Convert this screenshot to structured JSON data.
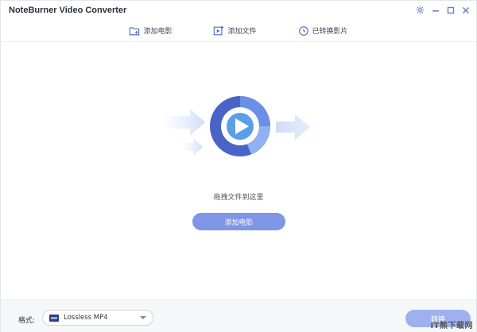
{
  "app": {
    "title": "NoteBurner Video Converter"
  },
  "window_controls": [
    {
      "name": "settings-icon",
      "symbol": "⚙"
    },
    {
      "name": "minimize-icon",
      "symbol": "–"
    },
    {
      "name": "maximize-icon",
      "symbol": "□"
    },
    {
      "name": "close-icon",
      "symbol": "✕"
    }
  ],
  "toolbar": {
    "add_movie": "添加电影",
    "add_file": "添加文件",
    "converted": "已转换影片"
  },
  "main": {
    "drop_hint": "拖拽文件到这里",
    "add_movie_button": "添加电影"
  },
  "footer": {
    "format_label": "格式:",
    "format_value": "Lossless MP4",
    "convert_button": "转换"
  },
  "watermark": "IT熊下载网",
  "colors": {
    "accent": "#7f95e8",
    "ring_dark": "#4a63c7",
    "ring_light": "#7fa8ee",
    "play": "#5aa0e8"
  }
}
